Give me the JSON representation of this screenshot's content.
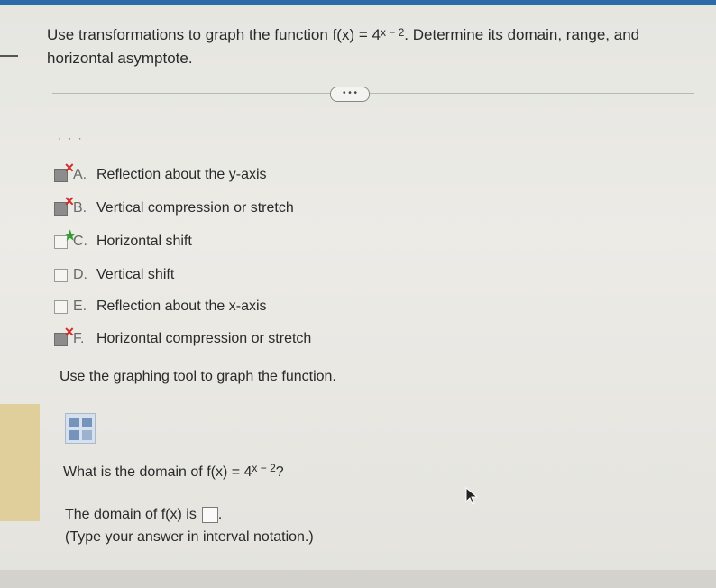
{
  "question": {
    "prefix": "Use transformations to graph the function ",
    "fx_base": "f(x) = 4",
    "fx_exp": "x − 2",
    "suffix": ". Determine its domain, range, and",
    "line2": "horizontal asymptote."
  },
  "ellipsis_label": "• • •",
  "options": [
    {
      "letter": "A.",
      "text": "Reflection about the y-axis",
      "status": "incorrect",
      "checked": true
    },
    {
      "letter": "B.",
      "text": "Vertical compression or stretch",
      "status": "incorrect",
      "checked": true
    },
    {
      "letter": "C.",
      "text": "Horizontal shift",
      "status": "correct",
      "checked": false
    },
    {
      "letter": "D.",
      "text": "Vertical shift",
      "status": "none",
      "checked": false
    },
    {
      "letter": "E.",
      "text": "Reflection about the x-axis",
      "status": "none",
      "checked": false
    },
    {
      "letter": "F.",
      "text": "Horizontal compression or stretch",
      "status": "incorrect",
      "checked": true
    }
  ],
  "graph_prompt": "Use the graphing tool to graph the function.",
  "domain_question": {
    "prefix": "What is the domain of ",
    "fx_base": "f(x) = 4",
    "fx_exp": "x − 2",
    "suffix": "?"
  },
  "domain_answer": {
    "prefix": "The domain of f(x) is",
    "suffix": "."
  },
  "hint": "(Type your answer in interval notation.)",
  "colors": {
    "incorrect": "#d22a2a",
    "correct": "#2f9e2f",
    "accent": "#2d6aa8"
  }
}
